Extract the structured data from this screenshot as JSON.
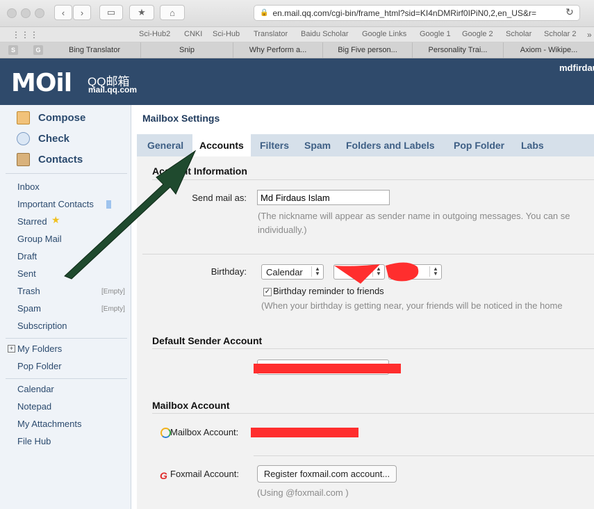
{
  "browser": {
    "url": "en.mail.qq.com/cgi-bin/frame_html?sid=KI4nDMRirf0IPiN0,2,en_US&r=",
    "bookmarks": [
      "Sci-Hub2",
      "CNKI",
      "Sci-Hub",
      "Translator",
      "Baidu Scholar",
      "Google Links",
      "Google 1",
      "Google 2",
      "Scholar",
      "Scholar 2"
    ],
    "tabs": [
      "Bing Translator",
      "Snip",
      "Why Perform a...",
      "Big Five person...",
      "Personality Trai...",
      "Axiom - Wikipe..."
    ],
    "tab_badges": [
      "S",
      "G"
    ]
  },
  "header": {
    "logo": "MOil",
    "brand": "QQ邮箱",
    "domain": "mail.qq.com",
    "user": "mdfirdaus"
  },
  "sidebar": {
    "actions": [
      {
        "label": "Compose",
        "color": "#e8a43a"
      },
      {
        "label": "Check",
        "color": "#8fb1d6"
      },
      {
        "label": "Contacts",
        "color": "#c79a5a"
      }
    ],
    "folders": [
      "Inbox",
      "Important Contacts",
      "Starred",
      "Group Mail",
      "Draft",
      "Sent",
      "Trash",
      "Spam",
      "Subscription"
    ],
    "empty_label": "[Empty]",
    "my_folders": "My Folders",
    "pop_folder": "Pop Folder",
    "tools": [
      "Calendar",
      "Notepad",
      "My Attachments",
      "File Hub"
    ]
  },
  "settings": {
    "title": "Mailbox Settings",
    "tabs": [
      "General",
      "Accounts",
      "Filters",
      "Spam",
      "Folders and Labels",
      "Pop Folder",
      "Labs"
    ],
    "active_tab": "Accounts",
    "account_info_heading": "Account Information",
    "send_as_label": "Send mail as:",
    "send_as_value": "Md Firdaus Islam",
    "nickname_hint_1": "(The nickname will appear as sender name in outgoing messages. You can se",
    "nickname_hint_2": "individually.)",
    "birthday_label": "Birthday:",
    "birthday_calendar": "Calendar",
    "birthday_reminder": "Birthday reminder to friends",
    "birthday_reminder_checked": true,
    "birthday_hint": "(When your birthday is getting near, your friends will be noticed in the home",
    "default_sender_heading": "Default Sender Account",
    "mailbox_account_heading": "Mailbox Account",
    "mailbox_account_label": "Mailbox Account:",
    "foxmail_label": "Foxmail Account:",
    "foxmail_button": "Register foxmail.com account...",
    "foxmail_hint": "(Using @foxmail.com )"
  },
  "colors": {
    "header_bg": "#2f4a6b",
    "redaction": "#ff2e2e",
    "arrow": "#1f4a2e"
  }
}
